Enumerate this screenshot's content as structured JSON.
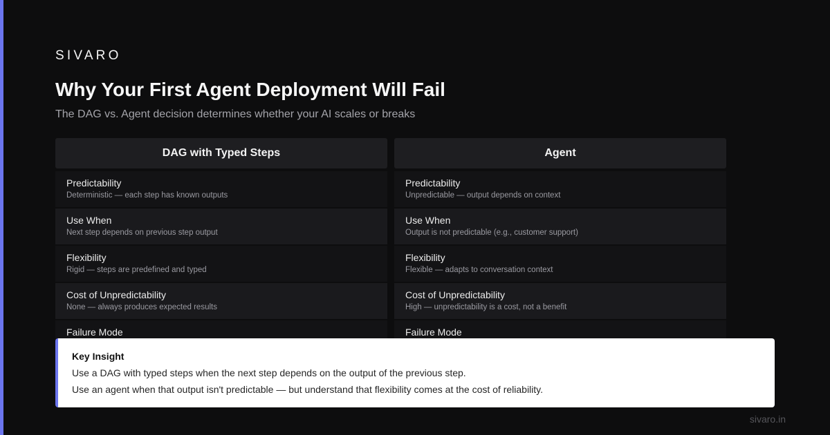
{
  "brand": "SIVARO",
  "title": "Why Your First Agent Deployment Will Fail",
  "subtitle": "The DAG vs. Agent decision determines whether your AI scales or breaks",
  "columns": [
    {
      "header": "DAG with Typed Steps",
      "rows": [
        {
          "label": "Predictability",
          "desc": "Deterministic — each step has known outputs"
        },
        {
          "label": "Use When",
          "desc": "Next step depends on previous step output"
        },
        {
          "label": "Flexibility",
          "desc": "Rigid — steps are predefined and typed"
        },
        {
          "label": "Cost of Unpredictability",
          "desc": "None — always produces expected results"
        },
        {
          "label": "Failure Mode",
          "desc": ""
        }
      ]
    },
    {
      "header": "Agent",
      "rows": [
        {
          "label": "Predictability",
          "desc": "Unpredictable — output depends on context"
        },
        {
          "label": "Use When",
          "desc": "Output is not predictable (e.g., customer support)"
        },
        {
          "label": "Flexibility",
          "desc": "Flexible — adapts to conversation context"
        },
        {
          "label": "Cost of Unpredictability",
          "desc": "High — unpredictability is a cost, not a benefit"
        },
        {
          "label": "Failure Mode",
          "desc": ""
        }
      ]
    }
  ],
  "insight": {
    "title": "Key Insight",
    "line1": "Use a DAG with typed steps when the next step depends on the output of the previous step.",
    "line2": "Use an agent when that output isn't predictable — but understand that flexibility comes at the cost of reliability."
  },
  "footer": {
    "site": "sivaro.in"
  },
  "colors": {
    "background": "#0d0d0e",
    "accent": "#6b75ee",
    "header_bg": "#1e1e21",
    "row_dark": "#131315",
    "row_light": "#1a1a1d",
    "card_bg": "#ffffff"
  }
}
